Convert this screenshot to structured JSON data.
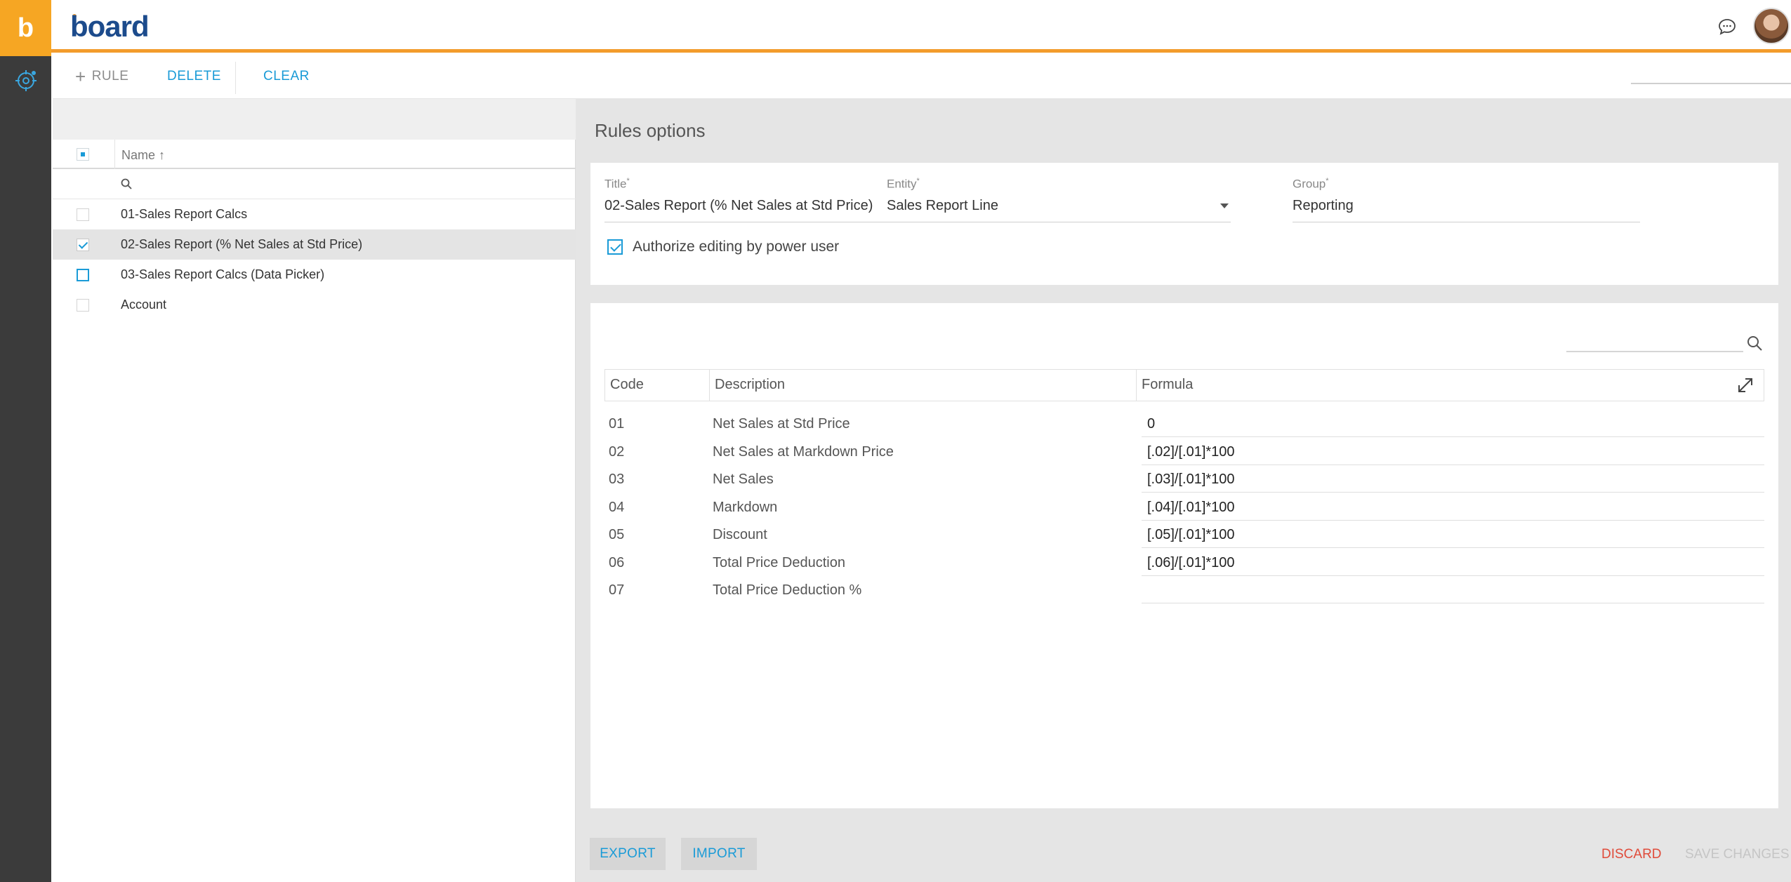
{
  "app": {
    "logo_letter": "b",
    "brand": "board"
  },
  "toolbar": {
    "rule_label": "RULE",
    "delete_label": "DELETE",
    "clear_label": "CLEAR",
    "search_placeholder": ""
  },
  "list": {
    "column_name": "Name",
    "sort_indicator": "↑",
    "filter_placeholder": "",
    "items": [
      {
        "label": "01-Sales Report Calcs",
        "checked": false
      },
      {
        "label": "02-Sales Report (% Net Sales at Std Price)",
        "checked": true
      },
      {
        "label": "03-Sales Report Calcs (Data Picker)",
        "checked": false
      },
      {
        "label": "Account",
        "checked": false
      }
    ]
  },
  "options": {
    "heading": "Rules options",
    "title_label": "Title",
    "title_value": "02-Sales Report (% Net Sales at Std Price)",
    "entity_label": "Entity",
    "entity_value": "Sales Report Line",
    "group_label": "Group",
    "group_value": "Reporting",
    "required_mark": "*",
    "authorize_label": "Authorize editing by power user",
    "authorize_checked": true
  },
  "table": {
    "search_placeholder": "",
    "columns": [
      "Code",
      "Description",
      "Formula"
    ],
    "rows": [
      {
        "code": "01",
        "description": "Net Sales at Std Price",
        "formula": "0"
      },
      {
        "code": "02",
        "description": "Net Sales at Markdown Price",
        "formula": "[.02]/[.01]*100"
      },
      {
        "code": "03",
        "description": "Net Sales",
        "formula": "[.03]/[.01]*100"
      },
      {
        "code": "04",
        "description": "Markdown",
        "formula": "[.04]/[.01]*100"
      },
      {
        "code": "05",
        "description": "Discount",
        "formula": "[.05]/[.01]*100"
      },
      {
        "code": "06",
        "description": "Total Price Deduction",
        "formula": "[.06]/[.01]*100"
      },
      {
        "code": "07",
        "description": "Total Price Deduction %",
        "formula": ""
      }
    ]
  },
  "footer": {
    "export_label": "EXPORT",
    "import_label": "IMPORT",
    "discard_label": "DISCARD",
    "save_label": "SAVE CHANGES"
  },
  "colors": {
    "accent": "#1a9bd7",
    "brand_orange": "#f39c2c",
    "danger": "#e04b3a",
    "rail": "#3b3b3b"
  }
}
